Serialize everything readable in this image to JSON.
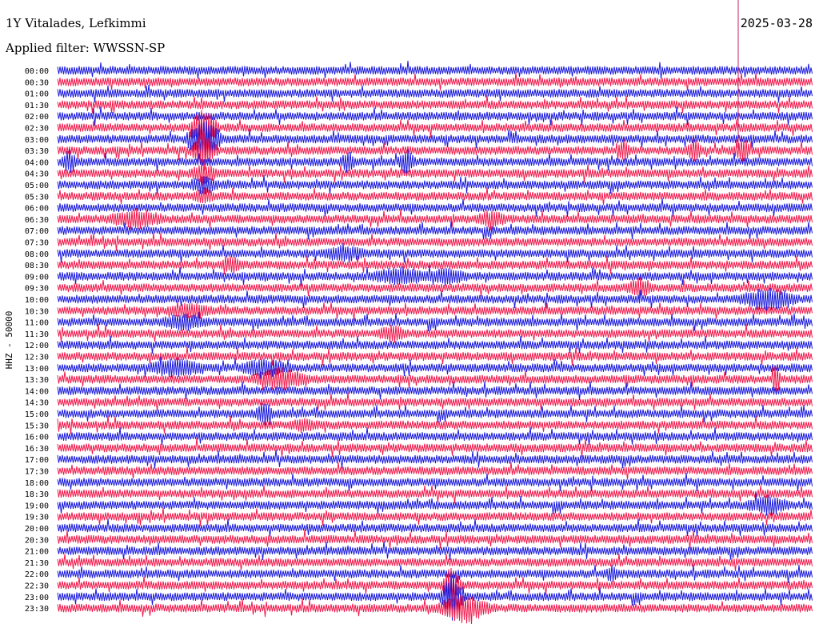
{
  "header": {
    "title": "1Y Vitalades, Lefkimmi",
    "date": "2025-03-28",
    "filter": "Applied filter: WWSSN-SP"
  },
  "chart_data": {
    "type": "helicorder",
    "ylabel": "HHZ - 50000",
    "row_labels": [
      "00:00",
      "00:30",
      "01:00",
      "01:30",
      "02:00",
      "02:30",
      "03:00",
      "03:30",
      "04:00",
      "04:30",
      "05:00",
      "05:30",
      "06:00",
      "06:30",
      "07:00",
      "07:30",
      "08:00",
      "08:30",
      "09:00",
      "09:30",
      "10:00",
      "10:30",
      "11:00",
      "11:30",
      "12:00",
      "12:30",
      "13:00",
      "13:30",
      "14:00",
      "14:30",
      "15:00",
      "15:30",
      "16:00",
      "16:30",
      "17:00",
      "17:30",
      "18:00",
      "18:30",
      "19:00",
      "19:30",
      "20:00",
      "20:30",
      "21:00",
      "21:30",
      "22:00",
      "22:30",
      "23:00",
      "23:30"
    ],
    "row_duration_minutes": 30,
    "series_colors": [
      "#1a1adc",
      "#f0194b"
    ],
    "marker_color": "#c0206a"
  }
}
